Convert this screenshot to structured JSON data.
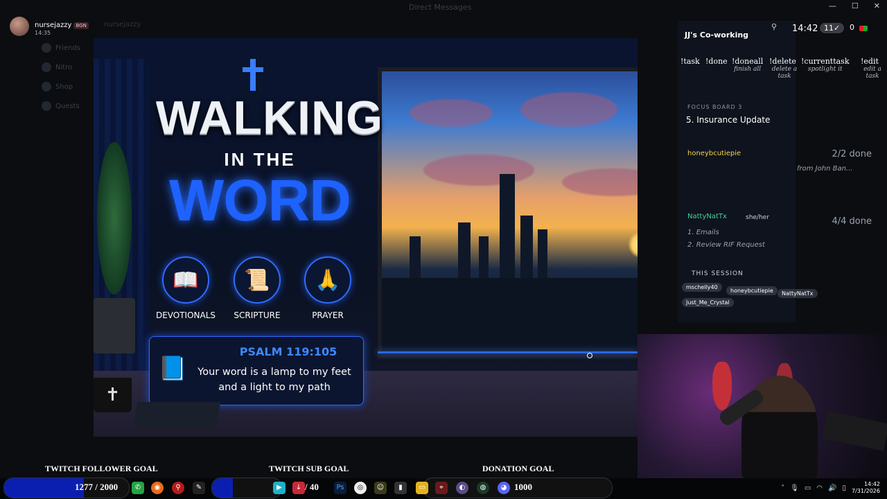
{
  "window": {
    "title": "Direct Messages"
  },
  "streamer": {
    "name": "nursejazzy",
    "tag": "BGN",
    "time": "14:35"
  },
  "dim_sidebar": {
    "items": [
      "Friends",
      "Nitro",
      "Shop",
      "Quests"
    ]
  },
  "dim_header": {
    "text": "nursejazzy"
  },
  "scene": {
    "title_line1": "WALKING",
    "title_line2": "IN THE",
    "title_line3": "WORD",
    "features": [
      {
        "label": "DEVOTIONALS",
        "icon": "open-book-icon",
        "glyph": "📖"
      },
      {
        "label": "SCRIPTURE",
        "icon": "scroll-icon",
        "glyph": "📜"
      },
      {
        "label": "PRAYER",
        "icon": "praying-hands-icon",
        "glyph": "🙏"
      }
    ],
    "verse": {
      "reference": "PSALM 119:105",
      "text": "Your word is a lamp to my feet and a light to my path"
    }
  },
  "cowork": {
    "title": "JJ's Co-working",
    "time": "14:42",
    "count": "11✓",
    "zero": "0",
    "commands": [
      {
        "name": "!task",
        "desc": ""
      },
      {
        "name": "!done",
        "desc": ""
      },
      {
        "name": "!doneall",
        "desc": "finish all"
      },
      {
        "name": "!delete",
        "desc": "delete a task"
      },
      {
        "name": "!currenttask",
        "desc": "spotlight it"
      },
      {
        "name": "!edit",
        "desc": "edit a task"
      }
    ],
    "focus_label": "FOCUS BOARD 3",
    "focus_task": "5. Insurance Update",
    "users": [
      {
        "name": "honeybcutiepie",
        "done": "2/2 done",
        "note": "from John Ban..."
      },
      {
        "name": "NattyNatTx",
        "pronoun": "she/her",
        "done": "4/4 done",
        "lines": [
          "1. Emails",
          "2. Review RIF Request"
        ]
      }
    ],
    "session_label": "THIS SESSION",
    "session_users": [
      "mschelly40",
      "honeybcutiepie",
      "NattyNatTx",
      "Just_Me_Crystal"
    ]
  },
  "goals": {
    "follower": {
      "label": "TWITCH FOLLOWER GOAL",
      "value": "1277 / 2000",
      "progress": 0.64
    },
    "sub": {
      "label": "TWITCH SUB GOAL",
      "value": "/ 40",
      "progress": 0.3
    },
    "donation": {
      "label": "DONATION GOAL",
      "value": "1000",
      "progress": 0.0
    }
  },
  "taskbar": {
    "clock_time": "14:42",
    "clock_date": "7/31/2026"
  },
  "colors": {
    "accent": "#1e62ff",
    "goal_fill": "#0a1fb0"
  }
}
